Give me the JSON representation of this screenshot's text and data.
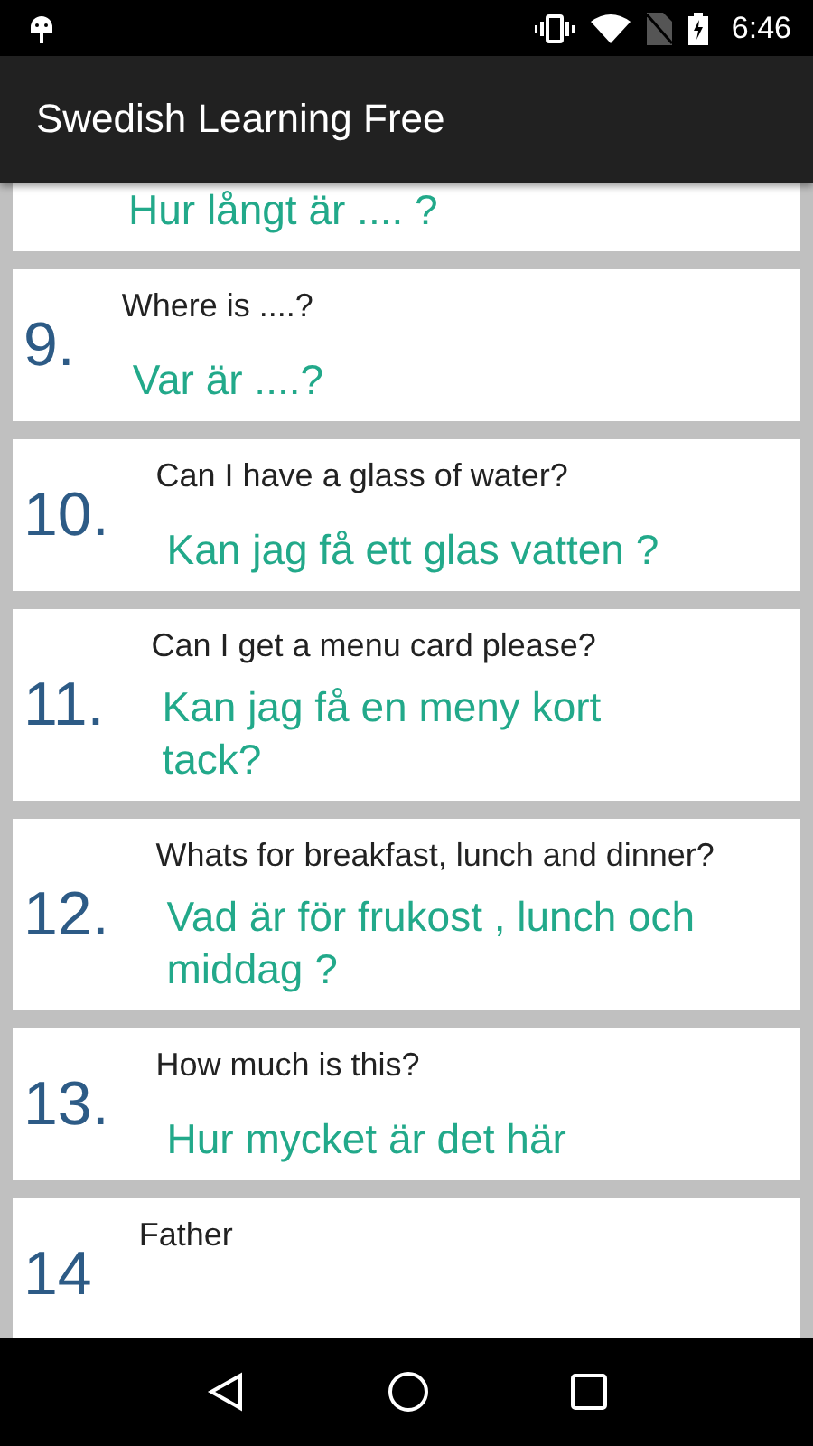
{
  "status_bar": {
    "time": "6:46"
  },
  "app_bar": {
    "title": "Swedish Learning Free"
  },
  "phrases": [
    {
      "swedish": "Hur långt är .... ?"
    },
    {
      "number": "9.",
      "english": "Where is ....?",
      "swedish": "Var är ....?"
    },
    {
      "number": "10.",
      "english": "Can I have a glass of water?",
      "swedish": "Kan jag få ett glas vatten ?"
    },
    {
      "number": "11.",
      "english": "Can I get a menu card please?",
      "swedish": "Kan jag få en meny kort\ntack?"
    },
    {
      "number": "12.",
      "english": "Whats for breakfast, lunch and dinner?",
      "swedish": "Vad är för frukost , lunch och\nmiddag ?"
    },
    {
      "number": "13.",
      "english": "How much is this?",
      "swedish": "Hur mycket är det här"
    },
    {
      "number": "14",
      "english": "Father"
    }
  ]
}
